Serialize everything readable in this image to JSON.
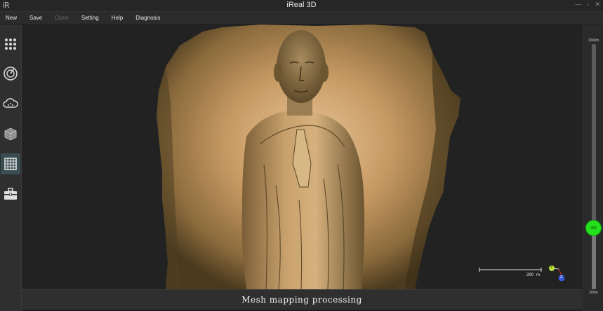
{
  "window": {
    "logo": "iR",
    "title": "iReal 3D",
    "controls": [
      "—",
      "▫",
      "✕"
    ]
  },
  "menu": {
    "items": [
      {
        "label": "New",
        "enabled": true
      },
      {
        "label": "Save",
        "enabled": true
      },
      {
        "label": "Open",
        "enabled": false
      },
      {
        "label": "Setting",
        "enabled": true
      },
      {
        "label": "Help",
        "enabled": true
      },
      {
        "label": "Diagnosis",
        "enabled": true
      }
    ]
  },
  "sidebar": {
    "tools": [
      {
        "icon": "dots-grid-icon",
        "active": false
      },
      {
        "icon": "scan-dial-icon",
        "active": false
      },
      {
        "icon": "cloud-icon",
        "active": false
      },
      {
        "icon": "mesh-cube-icon",
        "active": false
      },
      {
        "icon": "texture-grid-icon",
        "active": true
      },
      {
        "icon": "toolbox-icon",
        "active": false
      }
    ]
  },
  "viewport": {
    "scale_bar": {
      "value": "200",
      "unit": "m"
    },
    "axis": {
      "y": "Y",
      "z": "Z"
    }
  },
  "depth_slider": {
    "max_label": "1000m",
    "min_label": "200m",
    "value": 400,
    "min": 200,
    "max": 1000,
    "thumb_label": "400"
  },
  "status": {
    "text": "Mesh mapping processing"
  },
  "colors": {
    "accent": "#22e01a",
    "active_tool": "#3a4d52",
    "background": "#1e1e1e"
  }
}
